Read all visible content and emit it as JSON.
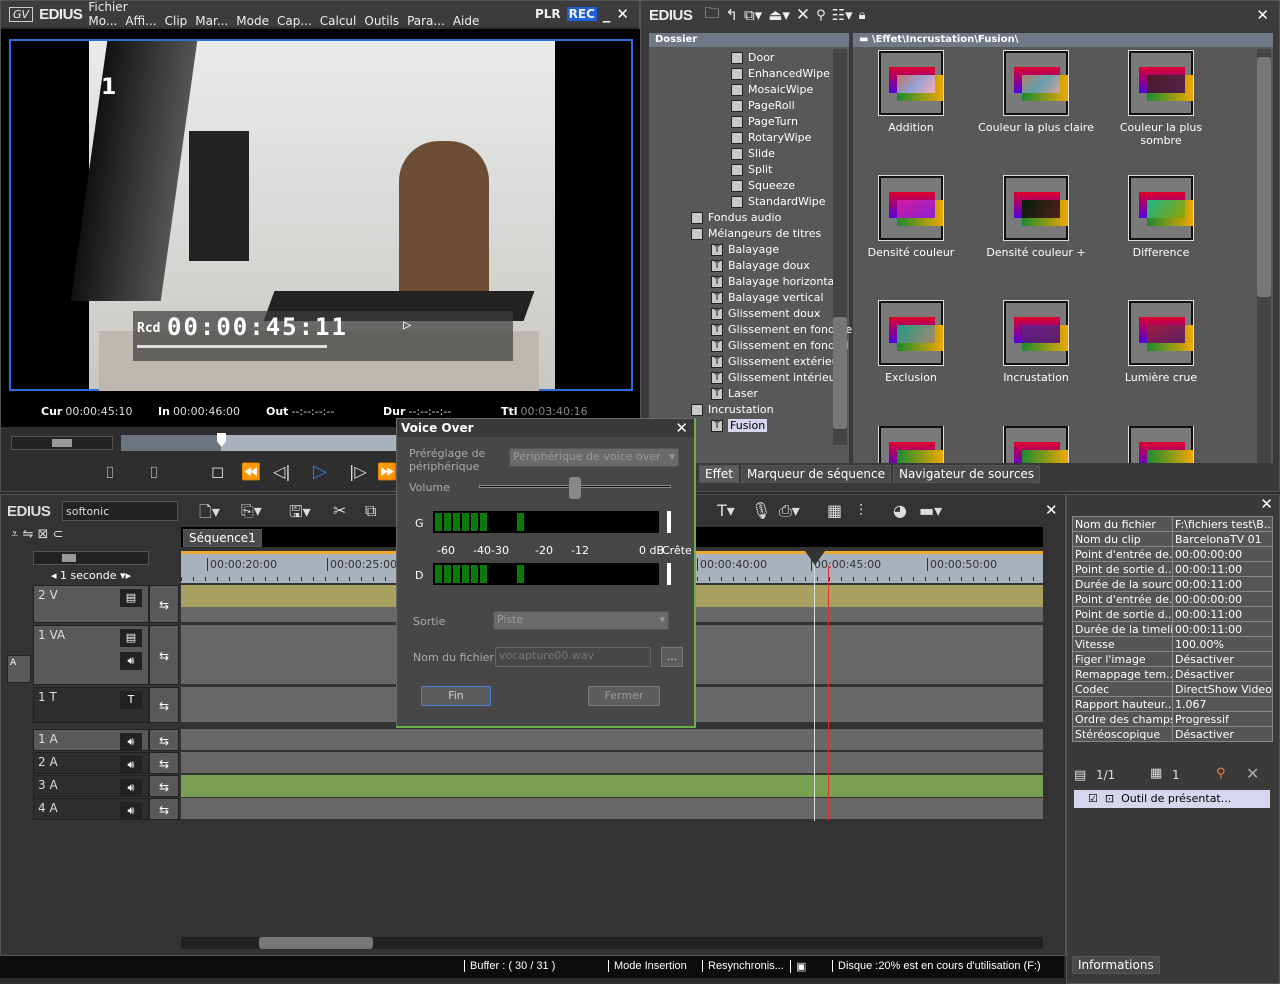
{
  "player": {
    "logo": "EDIUS",
    "menu": [
      "Fichier Mo...",
      "Affi...",
      "Clip",
      "Mar...",
      "Mode",
      "Cap...",
      "Calcul",
      "Outils",
      "Para...",
      "Aide"
    ],
    "plr": "PLR",
    "rec": "REC",
    "overlay_number": "1",
    "rcd_label": "Rcd",
    "rcd_timecode": "00:00:45:11",
    "cur_label": "Cur",
    "cur": "00:00:45:10",
    "in_label": "In",
    "in": "00:00:46:00",
    "out_label": "Out",
    "out": "--:--:--:--",
    "dur_label": "Dur",
    "dur": "--:--:--:--",
    "ttl_label": "Ttl",
    "ttl": "00:03:40:16",
    "rec_color": "#1e5fd6"
  },
  "browser": {
    "logo": "EDIUS",
    "folder_header": "Dossier",
    "path": "\\Effet\\Incrustation\\Fusion\\",
    "tree": [
      {
        "label": "Door",
        "level": 3
      },
      {
        "label": "EnhancedWipe",
        "level": 3
      },
      {
        "label": "MosaicWipe",
        "level": 3
      },
      {
        "label": "PageRoll",
        "level": 3
      },
      {
        "label": "PageTurn",
        "level": 3
      },
      {
        "label": "RotaryWipe",
        "level": 3
      },
      {
        "label": "Slide",
        "level": 3
      },
      {
        "label": "Split",
        "level": 3
      },
      {
        "label": "Squeeze",
        "level": 3
      },
      {
        "label": "StandardWipe",
        "level": 3
      },
      {
        "label": "Fondus audio",
        "level": 1
      },
      {
        "label": "Mélangeurs de titres",
        "level": 1
      },
      {
        "label": "Balayage",
        "level": 2
      },
      {
        "label": "Balayage doux",
        "level": 2
      },
      {
        "label": "Balayage horizontal",
        "level": 2
      },
      {
        "label": "Balayage vertical",
        "level": 2
      },
      {
        "label": "Glissement doux",
        "level": 2
      },
      {
        "label": "Glissement en fondu e",
        "level": 2
      },
      {
        "label": "Glissement en fondu i",
        "level": 2
      },
      {
        "label": "Glissement extérieur",
        "level": 2
      },
      {
        "label": "Glissement intérieur",
        "level": 2
      },
      {
        "label": "Laser",
        "level": 2
      },
      {
        "label": "Incrustation",
        "level": 1
      },
      {
        "label": "Fusion",
        "level": 2,
        "selected": true
      }
    ],
    "effects": [
      "Addition",
      "Couleur la plus claire",
      "Couleur la plus sombre",
      "Densité couleur",
      "Densité couleur +",
      "Difference",
      "Exclusion",
      "Incrustation",
      "Lumière crue"
    ],
    "tabs": [
      "Effet",
      "Marqueur de séquence",
      "Navigateur de sources"
    ]
  },
  "timeline": {
    "logo": "EDIUS",
    "project": "softonic",
    "sequence_tab": "Séquence1",
    "scale": "1 seconde",
    "ruler": [
      "00:00:20:00",
      "00:00:25:00",
      "00:00:40:00",
      "00:00:45:00",
      "00:00:50:00"
    ],
    "tracks": [
      "2 V",
      "1 VA",
      "1 T",
      "1 A",
      "2 A",
      "3 A",
      "4 A"
    ],
    "a_label": "A",
    "a_nums": "1\n2"
  },
  "voice_over": {
    "title": "Voice Over",
    "preset_label": "Préréglage de périphérique",
    "preset_value": "Périphérique de voice over",
    "volume_label": "Volume",
    "volume_level": 0.5,
    "left": "G",
    "right": "D",
    "scale": [
      "-60",
      "-40",
      "-30",
      "-20",
      "-12",
      "0 dB"
    ],
    "peak": "Crête",
    "output_label": "Sortie",
    "output_value": "Piste",
    "filename_label": "Nom du fichier",
    "filename": "vocapture00.wav",
    "browse": "...",
    "fin": "Fin",
    "close": "Fermer"
  },
  "info": {
    "rows": [
      [
        "Nom du fichier",
        "F:\\fichiers test\\B..."
      ],
      [
        "Nom du clip",
        "BarcelonaTV 01"
      ],
      [
        "Point d'entrée de...",
        "00:00:00:00"
      ],
      [
        "Point de sortie d...",
        "00:00:11:00"
      ],
      [
        "Durée de la source",
        "00:00:11:00"
      ],
      [
        "Point d'entrée de...",
        "00:00:00:00"
      ],
      [
        "Point de sortie d...",
        "00:00:11:00"
      ],
      [
        "Durée de la timeline",
        "00:00:11:00"
      ],
      [
        "Vitesse",
        "100.00%"
      ],
      [
        "Figer l'image",
        "Désactiver"
      ],
      [
        "Remappage tem...",
        "Désactiver"
      ],
      [
        "Codec",
        "DirectShow Video"
      ],
      [
        "Rapport hauteur...",
        "1.067"
      ],
      [
        "Ordre des champs",
        "Progressif"
      ],
      [
        "Stéréoscopique",
        "Désactiver"
      ]
    ],
    "clip_count": "1/1",
    "layer_count": "1",
    "layer_item": "Outil de présentat...",
    "tab": "Informations"
  },
  "status": {
    "buffer": "Buffer : ( 30 / 31 )",
    "mode": "Mode Insertion",
    "resync": "Resynchronis...",
    "disk": "Disque :20% est en cours d'utilisation (F:)"
  }
}
